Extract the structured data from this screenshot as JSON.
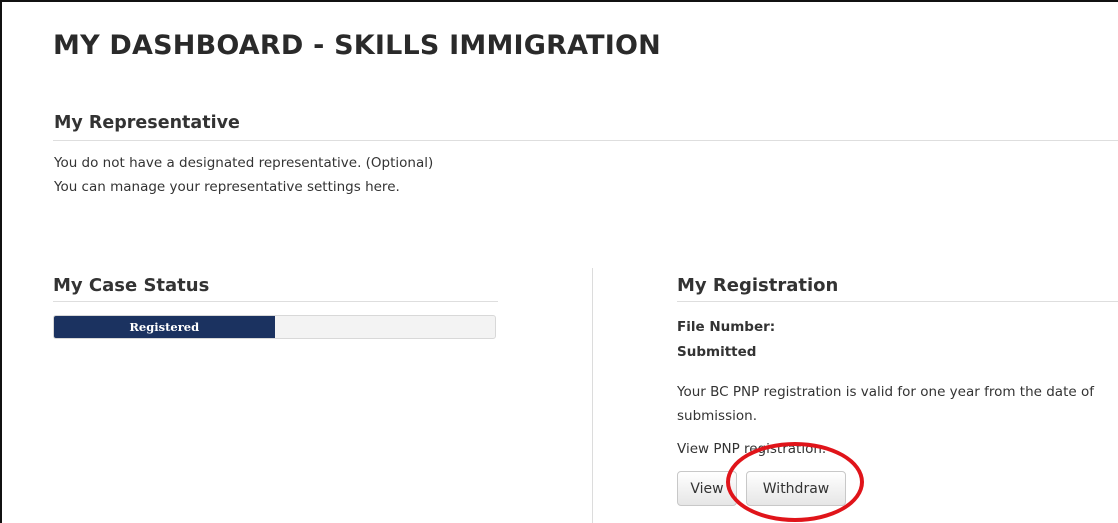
{
  "page": {
    "title": "MY DASHBOARD - SKILLS IMMIGRATION"
  },
  "representative": {
    "heading": "My Representative",
    "line1": "You do not have a designated representative. (Optional)",
    "line2": "You can manage your representative settings here."
  },
  "case_status": {
    "heading": "My Case Status",
    "progress_label": "Registered",
    "progress_fraction": 0.5,
    "progress_color": "#1b3260"
  },
  "registration": {
    "heading": "My Registration",
    "file_number_label": "File Number:",
    "status": "Submitted",
    "validity_text": "Your BC PNP registration is valid for one year from the date of submission.",
    "view_link_text": "View PNP registration.",
    "view_button": "View",
    "withdraw_button": "Withdraw"
  },
  "annotation": {
    "color": "#e0141a"
  }
}
